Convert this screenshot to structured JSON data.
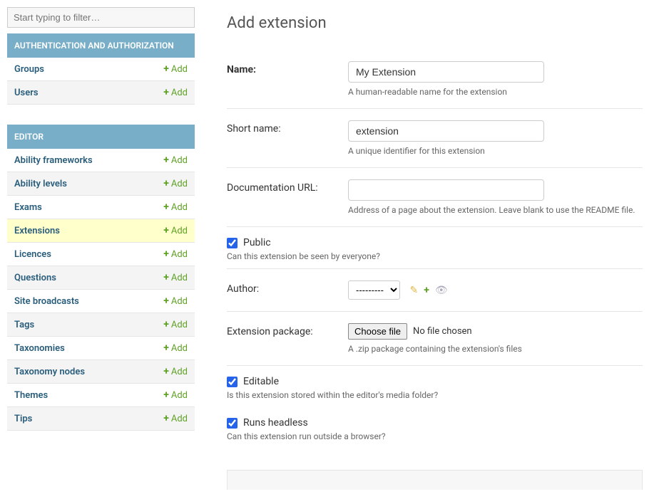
{
  "sidebar": {
    "filter_placeholder": "Start typing to filter…",
    "add_label": "Add",
    "sections": [
      {
        "title": "AUTHENTICATION AND AUTHORIZATION",
        "items": [
          {
            "label": "Groups"
          },
          {
            "label": "Users"
          }
        ]
      },
      {
        "title": "EDITOR",
        "items": [
          {
            "label": "Ability frameworks"
          },
          {
            "label": "Ability levels"
          },
          {
            "label": "Exams"
          },
          {
            "label": "Extensions",
            "highlighted": true
          },
          {
            "label": "Licences"
          },
          {
            "label": "Questions"
          },
          {
            "label": "Site broadcasts"
          },
          {
            "label": "Tags"
          },
          {
            "label": "Taxonomies"
          },
          {
            "label": "Taxonomy nodes"
          },
          {
            "label": "Themes"
          },
          {
            "label": "Tips"
          }
        ]
      }
    ]
  },
  "main": {
    "title": "Add extension",
    "fields": {
      "name": {
        "label": "Name:",
        "value": "My Extension",
        "help": "A human-readable name for the extension"
      },
      "short_name": {
        "label": "Short name:",
        "value": "extension",
        "help": "A unique identifier for this extension"
      },
      "doc_url": {
        "label": "Documentation URL:",
        "value": "",
        "help": "Address of a page about the extension. Leave blank to use the README file."
      },
      "public": {
        "label": "Public",
        "help": "Can this extension be seen by everyone?"
      },
      "author": {
        "label": "Author:",
        "selected": "---------"
      },
      "package": {
        "label": "Extension package:",
        "button": "Choose file",
        "no_file": "No file chosen",
        "help": "A .zip package containing the extension's files"
      },
      "editable": {
        "label": "Editable",
        "help": "Is this extension stored within the editor's media folder?"
      },
      "runs_headless": {
        "label": "Runs headless",
        "help": "Can this extension run outside a browser?"
      }
    }
  }
}
